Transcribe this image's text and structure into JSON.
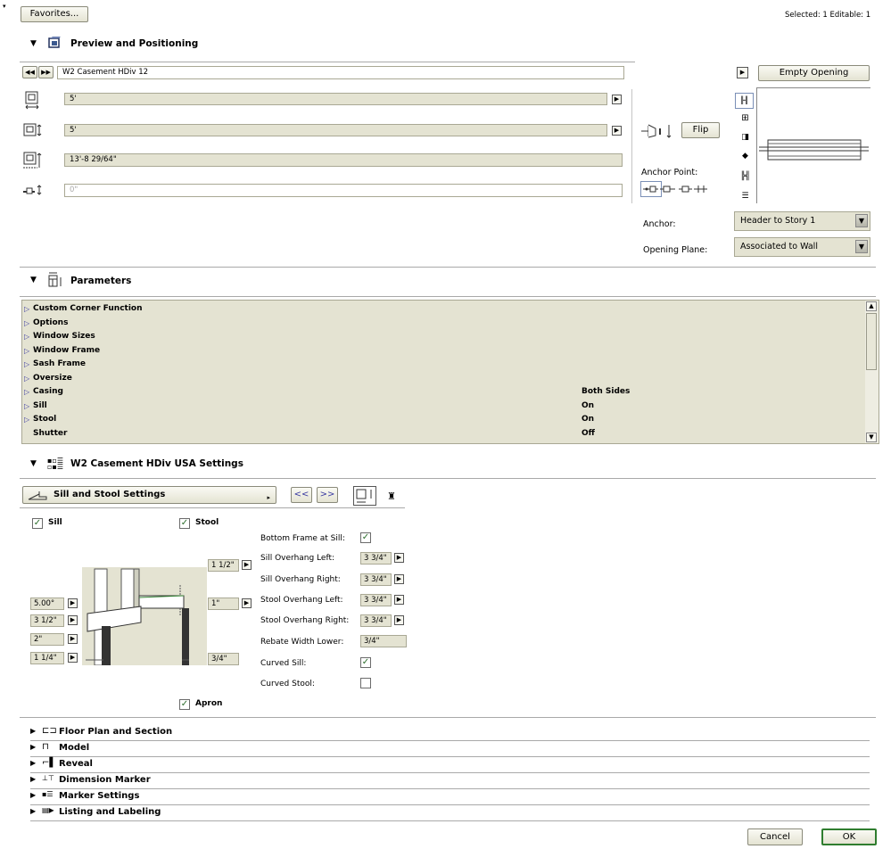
{
  "header": {
    "favorites_label": "Favorites...",
    "selected_text": "Selected: 1 Editable: 1"
  },
  "preview": {
    "title": "Preview and Positioning",
    "object_name": "W2 Casement HDiv 12",
    "empty_opening_label": "Empty Opening",
    "width_value": "5'",
    "height_value": "5'",
    "story_height_value": "13'-8 29/64\"",
    "offset_value": "0\"",
    "flip_label": "Flip",
    "anchor_point_label": "Anchor Point:",
    "anchor_label": "Anchor:",
    "anchor_value": "Header to Story 1",
    "opening_plane_label": "Opening Plane:",
    "opening_plane_value": "Associated to Wall"
  },
  "parameters": {
    "title": "Parameters",
    "rows": [
      {
        "name": "Custom Corner Function",
        "value": "",
        "expandable": true
      },
      {
        "name": "Options",
        "value": "",
        "expandable": true
      },
      {
        "name": "Window Sizes",
        "value": "",
        "expandable": true
      },
      {
        "name": "Window Frame",
        "value": "",
        "expandable": true
      },
      {
        "name": "Sash Frame",
        "value": "",
        "expandable": true
      },
      {
        "name": "Oversize",
        "value": "",
        "expandable": true
      },
      {
        "name": "Casing",
        "value": "Both Sides",
        "expandable": true
      },
      {
        "name": "Sill",
        "value": "On",
        "expandable": true
      },
      {
        "name": "Stool",
        "value": "On",
        "expandable": true
      },
      {
        "name": "Shutter",
        "value": "Off",
        "expandable": false
      }
    ]
  },
  "settings": {
    "title": "W2 Casement HDiv USA Settings",
    "page_select": "Sill and Stool Settings",
    "prev_label": "<<",
    "next_label": ">>",
    "sill_label": "Sill",
    "stool_label": "Stool",
    "apron_label": "Apron",
    "left_values": [
      "5.00°",
      "3 1/2\"",
      "2\"",
      "1 1/4\""
    ],
    "right_values": [
      "1 1/2\"",
      "1\"",
      "3/4\""
    ],
    "props": [
      {
        "label": "Bottom Frame at Sill:",
        "type": "check",
        "checked": true,
        "value": ""
      },
      {
        "label": "Sill Overhang Left:",
        "type": "value",
        "value": "3 3/4\""
      },
      {
        "label": "Sill Overhang Right:",
        "type": "value",
        "value": "3 3/4\""
      },
      {
        "label": "Stool Overhang Left:",
        "type": "value",
        "value": "3 3/4\""
      },
      {
        "label": "Stool Overhang Right:",
        "type": "value",
        "value": "3 3/4\""
      },
      {
        "label": "Rebate Width Lower:",
        "type": "field",
        "value": "3/4\""
      },
      {
        "label": "Curved Sill:",
        "type": "check",
        "checked": true,
        "value": ""
      },
      {
        "label": "Curved Stool:",
        "type": "check",
        "checked": false,
        "value": ""
      }
    ]
  },
  "bottom_sections": [
    {
      "label": "Floor Plan and Section",
      "icon": "floor-plan-icon"
    },
    {
      "label": "Model",
      "icon": "model-icon"
    },
    {
      "label": "Reveal",
      "icon": "reveal-icon"
    },
    {
      "label": "Dimension Marker",
      "icon": "dimension-marker-icon"
    },
    {
      "label": "Marker Settings",
      "icon": "marker-settings-icon"
    },
    {
      "label": "Listing and Labeling",
      "icon": "listing-icon"
    }
  ],
  "footer": {
    "cancel_label": "Cancel",
    "ok_label": "OK"
  },
  "colors": {
    "field_bg": "#e4e3d2",
    "ok_border": "#2f7d2f"
  }
}
